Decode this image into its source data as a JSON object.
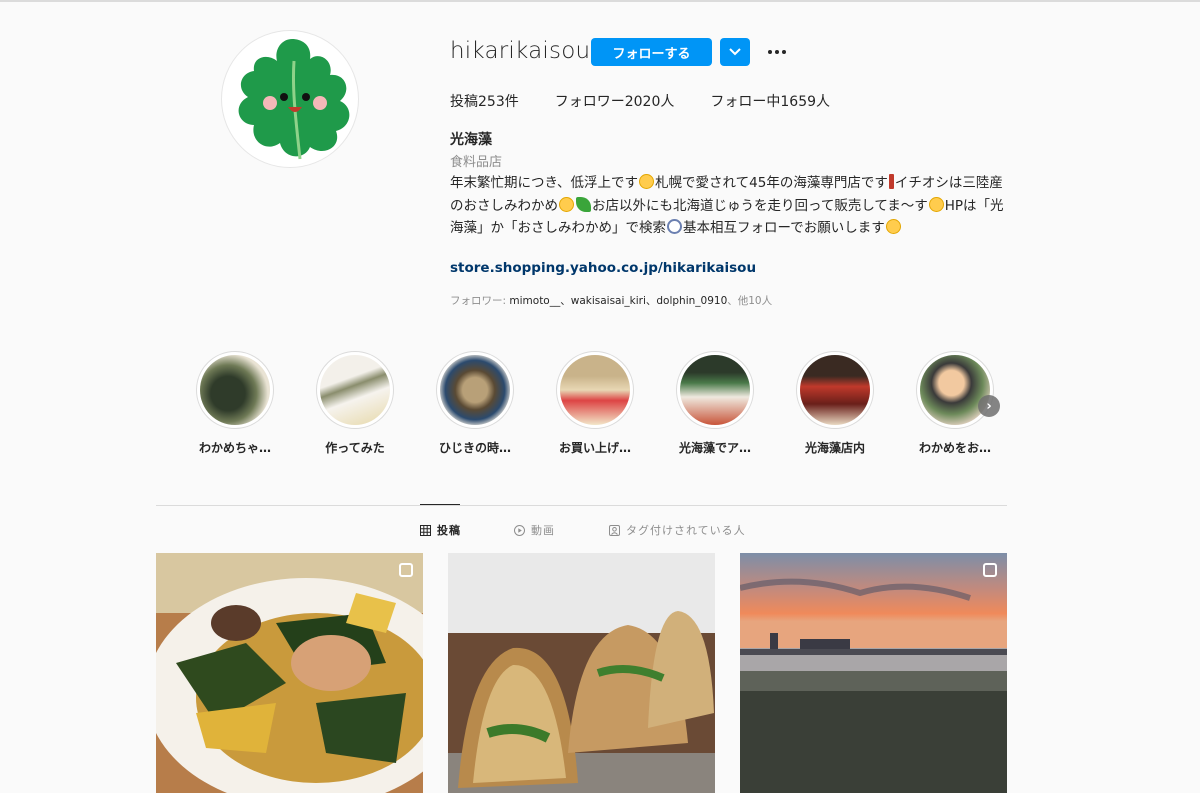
{
  "profile": {
    "username": "hikarikaisou",
    "follow_label": "フォローする",
    "stats": {
      "posts": "投稿253件",
      "followers": "フォロワー2020人",
      "following": "フォロー中1659人"
    },
    "display_name": "光海藻",
    "category": "食料品店",
    "bio": {
      "part1": "年末繁忙期につき、低浮上です",
      "part2": "札幌で愛されて45年の海藻専門店です",
      "part3": "イチオシは三陸産のおさしみわかめ",
      "part4": "お店以外にも北海道じゅうを走り回って販売してま〜す",
      "part5": "HPは「光海藻」か「おさしみわかめ」で検索",
      "part6": "基本相互フォローでお願いします"
    },
    "link": "store.shopping.yahoo.co.jp/hikarikaisou",
    "followed_by_prefix": "フォロワー: ",
    "followed_by_names": "mimoto__、wakisaisai_kiri、dolphin_0910",
    "followed_by_suffix": "、他10人"
  },
  "highlights": [
    {
      "label": "わかめちゃ…",
      "icon": "highlight-cover"
    },
    {
      "label": "作ってみた",
      "icon": "highlight-cover"
    },
    {
      "label": "ひじきの時…",
      "icon": "highlight-cover"
    },
    {
      "label": "お買い上げ…",
      "icon": "highlight-cover"
    },
    {
      "label": "光海藻でア…",
      "icon": "highlight-cover"
    },
    {
      "label": "光海藻店内",
      "icon": "highlight-cover"
    },
    {
      "label": "わかめをお…",
      "icon": "highlight-cover"
    }
  ],
  "tabs": [
    {
      "label": "投稿",
      "icon": "grid-icon",
      "active": true
    },
    {
      "label": "動画",
      "icon": "play-icon",
      "active": false
    },
    {
      "label": "タグ付けされている人",
      "icon": "tag-icon",
      "active": false
    }
  ],
  "colors": {
    "accent": "#0095f6",
    "link": "#00376b",
    "secondary_text": "#8e8e8e"
  }
}
